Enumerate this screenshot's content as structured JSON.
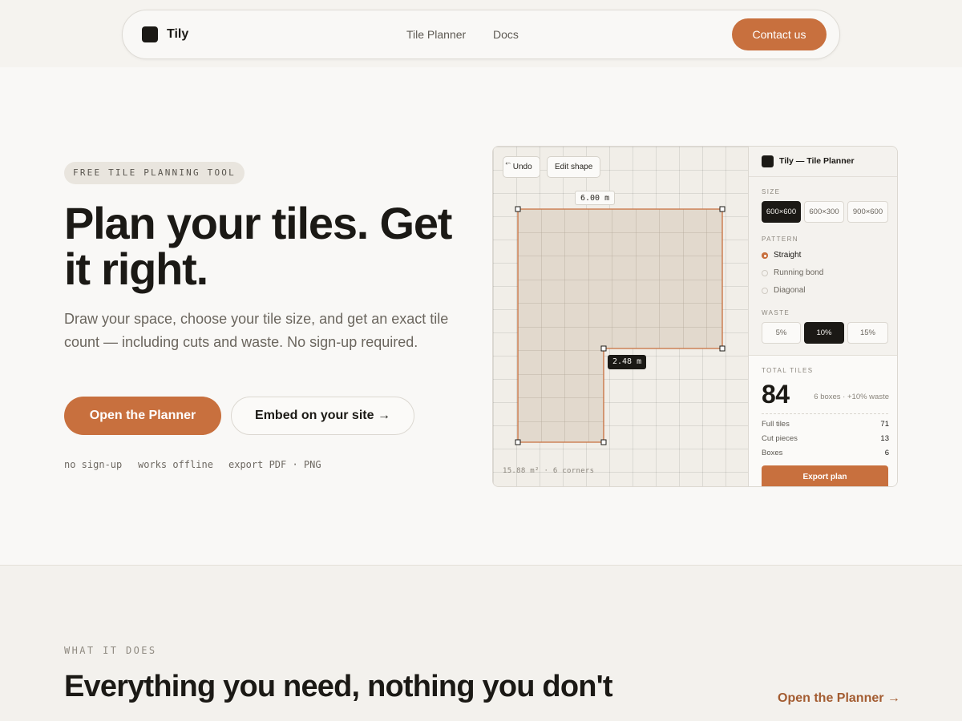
{
  "header": {
    "brand": "Tily",
    "nav": [
      "Tile Planner",
      "Docs"
    ],
    "contact_label": "Contact us"
  },
  "hero": {
    "badge": "FREE TILE PLANNING TOOL",
    "title": "Plan your tiles. Get it right.",
    "subtitle": "Draw your space, choose your tile size, and get an exact tile count — including cuts and waste. No sign-up required.",
    "primary_cta": "Open the Planner",
    "secondary_cta": "Embed on your site →",
    "features": [
      "no sign-up",
      "works offline",
      "export PDF · PNG"
    ]
  },
  "planner": {
    "toolbar": {
      "undo_label": "⃔ Undo",
      "edit_label": "Edit shape"
    },
    "dim_top": "6.00 m",
    "dim_step": "2.48 m",
    "footer": "15.88 m² · 6 corners",
    "panel_title": "Tily — Tile Planner",
    "size_label": "SIZE",
    "sizes": [
      "600×600",
      "600×300",
      "900×600"
    ],
    "selected_size": "600×600",
    "pattern_label": "PATTERN",
    "patterns": [
      "Straight",
      "Running bond",
      "Diagonal"
    ],
    "selected_pattern": "Straight",
    "waste_label": "WASTE",
    "wastes": [
      "5%",
      "10%",
      "15%"
    ],
    "selected_waste": "10%",
    "total_label": "TOTAL TILES",
    "total": "84",
    "total_note": "6 boxes · +10% waste",
    "rows": [
      {
        "label": "Full tiles",
        "value": "71"
      },
      {
        "label": "Cut pieces",
        "value": "13"
      },
      {
        "label": "Boxes",
        "value": "6"
      }
    ],
    "export_label": "Export plan",
    "colors": {
      "accent": "#c8703e",
      "tile_fill": "#e2d9cd",
      "outline": "#c8703e",
      "dark": "#1b1915"
    }
  },
  "features_section": {
    "eyebrow": "WHAT IT DOES",
    "title": "Everything you need, nothing you don't",
    "link": "Open the Planner →"
  }
}
